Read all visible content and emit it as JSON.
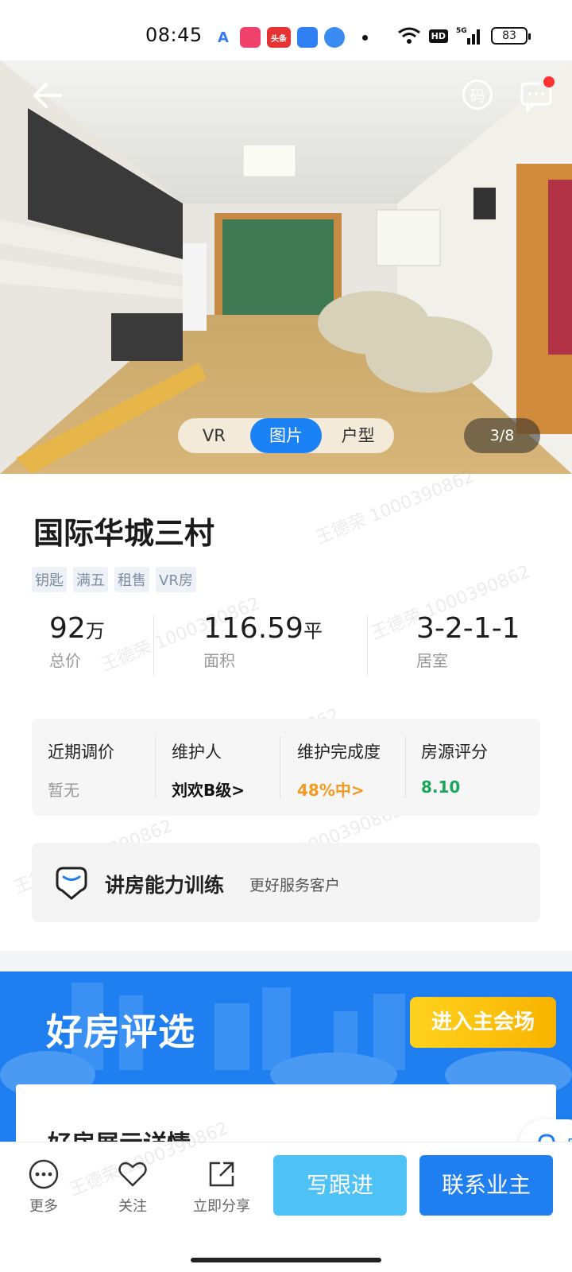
{
  "status_bar": {
    "time": "08:45",
    "signal": "5G",
    "hd": "HD",
    "battery": "83",
    "apps": [
      {
        "label": "A",
        "color": "#ffffff",
        "text_color": "#3a7bf0"
      },
      {
        "label": "",
        "color": "#f0406c"
      },
      {
        "label": "头条",
        "color": "#e63232"
      },
      {
        "label": "",
        "color": "#2f80f5"
      },
      {
        "label": "",
        "color": "#3b8cf2"
      }
    ]
  },
  "hero": {
    "media_tabs": [
      "VR",
      "图片",
      "户型"
    ],
    "active_tab": "图片",
    "counter": "3/8",
    "code_label": "码"
  },
  "listing": {
    "title": "国际华城三村",
    "tags": [
      "钥匙",
      "满五",
      "租售",
      "VR房"
    ],
    "stats": [
      {
        "value": "92",
        "unit": "万",
        "label": "总价"
      },
      {
        "value": "116.59",
        "unit": "平",
        "label": "面积"
      },
      {
        "value": "3-2-1-1",
        "unit": "",
        "label": "居室"
      }
    ]
  },
  "info_card": [
    {
      "key": "近期调价",
      "value": "暂无",
      "color": "#999999"
    },
    {
      "key": "维护人",
      "value": "刘欢B级>",
      "color": "#111111"
    },
    {
      "key": "维护完成度",
      "value": "48%中>",
      "color": "#f29a1f"
    },
    {
      "key": "房源评分",
      "value": "8.10",
      "color": "#1aa65a"
    }
  ],
  "training": {
    "title": "讲房能力训练",
    "subtitle": "更好服务客户"
  },
  "promo": {
    "title": "好房评选",
    "button": "进入主会场",
    "card_text": "好房展示详情"
  },
  "service_pill": {
    "label": "客"
  },
  "bottom_bar": {
    "more": "更多",
    "follow": "关注",
    "share": "立即分享",
    "write_follow": "写跟进",
    "contact_owner": "联系业主"
  },
  "watermark_text": "王德荣 1000390862"
}
